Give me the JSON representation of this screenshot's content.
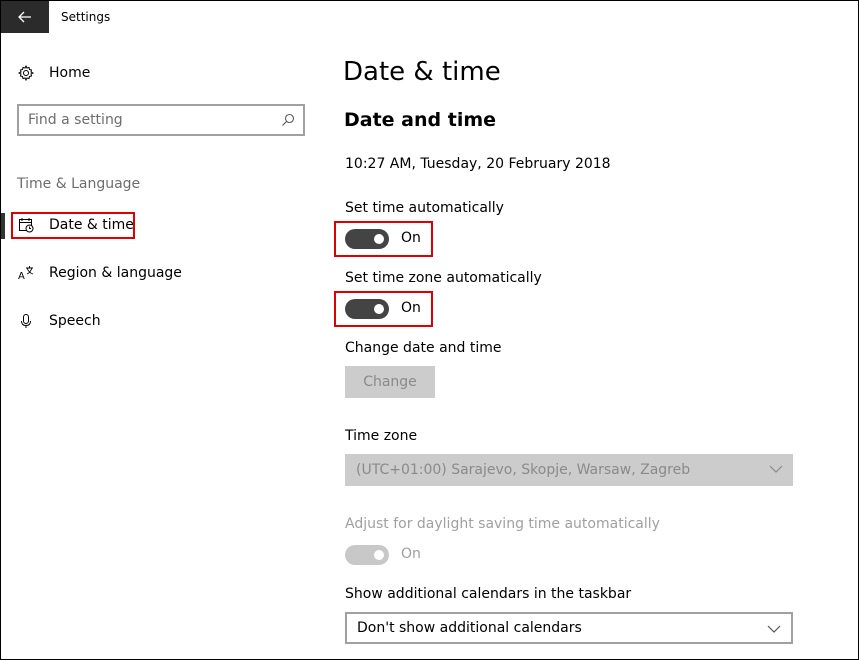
{
  "window": {
    "title": "Settings"
  },
  "sidebar": {
    "home_label": "Home",
    "search_placeholder": "Find a setting",
    "section_label": "Time & Language",
    "items": [
      {
        "label": "Date & time",
        "icon": "calendar-clock-icon",
        "active": true
      },
      {
        "label": "Region & language",
        "icon": "language-icon",
        "active": false
      },
      {
        "label": "Speech",
        "icon": "microphone-icon",
        "active": false
      }
    ]
  },
  "main": {
    "title": "Date & time",
    "subtitle": "Date and time",
    "current_time": "10:27 AM, Tuesday, 20 February 2018",
    "set_time_auto": {
      "label": "Set time automatically",
      "state": "On"
    },
    "set_timezone_auto": {
      "label": "Set time zone automatically",
      "state": "On"
    },
    "change_datetime": {
      "label": "Change date and time",
      "button": "Change"
    },
    "time_zone": {
      "label": "Time zone",
      "value": "(UTC+01:00) Sarajevo, Skopje, Warsaw, Zagreb"
    },
    "daylight": {
      "label": "Adjust for daylight saving time automatically",
      "state": "On"
    },
    "calendars": {
      "label": "Show additional calendars in the taskbar",
      "value": "Don't show additional calendars"
    }
  },
  "colors": {
    "highlight": "#e00000",
    "toggle_on": "#444444",
    "disabled": "#cccccc"
  }
}
